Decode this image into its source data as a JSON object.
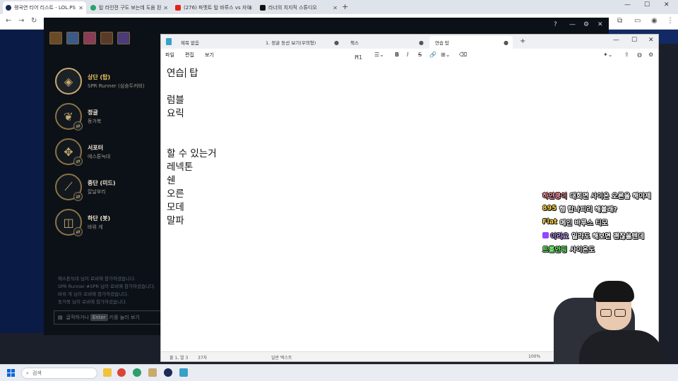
{
  "browser": {
    "tabs": [
      {
        "label": "랭곡연 티어 리스트 - LOL.PS",
        "active": true,
        "color": "#1c2a58"
      },
      {
        "label": "탑 라인전 구도 보는데 도움 된",
        "active": false,
        "color": "#27a36b"
      },
      {
        "label": "(276) 파멧트 탑 바루스 vs 자이",
        "active": false,
        "color": "#e62117"
      },
      {
        "label": "라너의 치지직 스튜디오",
        "active": false,
        "color": "#111111"
      }
    ]
  },
  "client": {
    "roles": [
      {
        "name": "상단 (탑)",
        "sub": "SPR Runner (심숭두커비)",
        "glyph": "◈",
        "selected": true
      },
      {
        "name": "정글",
        "sub": "동거북",
        "glyph": "❦",
        "selected": false
      },
      {
        "name": "서포터",
        "sub": "에스톤늑대",
        "glyph": "✥",
        "selected": false
      },
      {
        "name": "중단 (미드)",
        "sub": "칼날부리",
        "glyph": "⟋",
        "selected": false
      },
      {
        "name": "하단 (봇)",
        "sub": "바위 게",
        "glyph": "◫",
        "selected": false
      }
    ],
    "chatlog": [
      "에스톤늑대 님이 로비에 참가하셨습니다.",
      "SPR Runner #SPR 님이 로비에 참가하셨습니다.",
      "바위 게 님이 로비에 참가하셨습니다.",
      "동거북 님이 로비에 참가하셨습니다."
    ],
    "chat_input": {
      "pre": "글작하거나",
      "key": "Enter",
      "post": "키를 눌러 보기"
    }
  },
  "notepad": {
    "tabs": [
      {
        "label": "제목 없음",
        "active": false
      },
      {
        "label": "1. 정글 동선 보기(우의형)",
        "active": false
      },
      {
        "label": "책스",
        "active": false
      },
      {
        "label": "연습 탑",
        "active": true
      }
    ],
    "menu": {
      "file": "파일",
      "edit": "편집",
      "view": "보기"
    },
    "heading_style": "H1",
    "lines": [
      {
        "before": "연습",
        "after": " 탑"
      },
      {
        "before": "",
        "after": ""
      },
      {
        "before": "럼블",
        "after": ""
      },
      {
        "before": "요릭",
        "after": ""
      },
      {
        "before": "",
        "after": ""
      },
      {
        "before": "",
        "after": ""
      },
      {
        "before": "할 수 있는거",
        "after": ""
      },
      {
        "before": "레넥톤",
        "after": ""
      },
      {
        "before": "쉔",
        "after": ""
      },
      {
        "before": "오른",
        "after": ""
      },
      {
        "before": "모데",
        "after": ""
      },
      {
        "before": "말파",
        "after": ""
      }
    ],
    "status": {
      "position": "줄 1, 열 3",
      "chars": "37자",
      "format": "일반 텍스트",
      "zoom": "100%"
    }
  },
  "stream_chat": [
    {
      "user": "하얀쿵이",
      "text": "대회면 사이온 오른을 해야제",
      "color": "#ff9aa8",
      "badge": false
    },
    {
      "user": "895",
      "text": "형 탑나피리 해볼래?",
      "color": "#ffd54a",
      "badge": false
    },
    {
      "user": "Flat",
      "text": "메인 바루스 티모",
      "color": "#ffd54a",
      "badge": false
    },
    {
      "user": "이리요",
      "text": "일라도 해보면 괜찮을텐데",
      "color": "#c9a0ff",
      "badge": true
    },
    {
      "user": "트롤안밍",
      "text": "사이온도",
      "color": "#7dff7d",
      "badge": false
    }
  ],
  "taskbar": {
    "search_placeholder": "검색"
  }
}
